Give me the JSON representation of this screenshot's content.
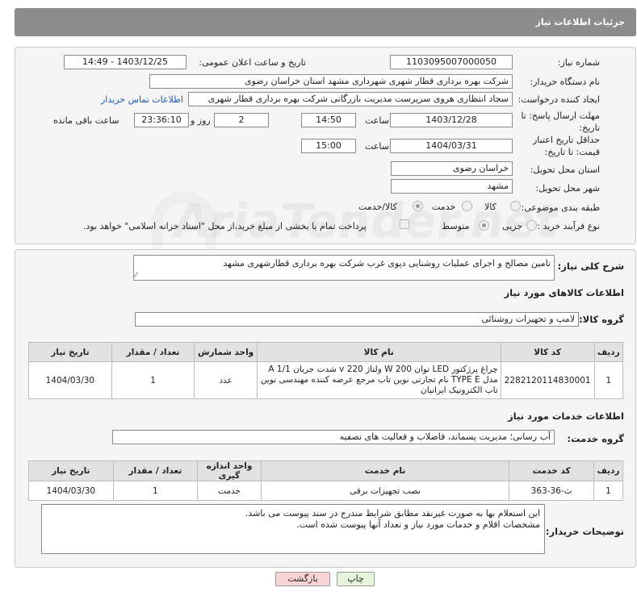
{
  "header": {
    "title": "جزئیات اطلاعات نیاز"
  },
  "form": {
    "need_number_label": "شماره نیاز:",
    "need_number": "1103095007000050",
    "announce_label": "تاریخ و ساعت اعلان عمومی:",
    "announce_value": "1403/12/25 - 14:49",
    "buyer_org_label": "نام دستگاه خریدار:",
    "buyer_org": "شرکت بهره برداری قطار شهری شهرداری مشهد استان خراسان رضوی",
    "requester_label": "ایجاد کننده درخواست:",
    "requester": "سجاد انتظاری هروی سرپرست مدیریت بازرگانی شرکت بهره برداری قطار شهری",
    "contact_link": "اطلاعات تماس خریدار",
    "send_deadline_label": "مهلت ارسال پاسخ: تا تاریخ:",
    "send_deadline_date": "1403/12/28",
    "time_word": "ساعت",
    "send_deadline_time": "14:50",
    "days_value": "2",
    "days_label": "روز و",
    "remaining_time": "23:36:10",
    "remaining_label": "ساعت باقی مانده",
    "price_validity_label": "حداقل تاریخ اعتبار قیمت: تا تاریخ:",
    "price_validity_date": "1404/03/31",
    "price_validity_time": "15:00",
    "province_label": "استان محل تحویل:",
    "province": "خراسان رضوی",
    "city_label": "شهر محل تحویل:",
    "city": "مشهد",
    "category_label": "طبقه بندی موضوعی:",
    "category_options": [
      "کالا",
      "خدمت",
      "کالا/خدمت"
    ],
    "process_label": "نوع فرآیند خرید :",
    "process_options": [
      "جزیی",
      "متوسط"
    ],
    "payment_note": "پرداخت تمام یا بخشی از مبلغ خرید،از محل \"اسناد خزانه اسلامی\" خواهد بود."
  },
  "description": {
    "label": "شرح کلی نیاز:",
    "value": "تامین مصالح و اجرای عملیات روشنایی دپوی غرب شرکت بهره برداری قطارشهری مشهد"
  },
  "goods": {
    "section_title": "اطلاعات کالاهای مورد نیاز",
    "group_label": "گروه کالا:",
    "group_value": "لامپ و تجهیزات روشنائی",
    "columns": [
      "ردیف",
      "کد کالا",
      "نام کالا",
      "واحد شمارش",
      "تعداد / مقدار",
      "تاریخ نیاز"
    ],
    "rows": [
      {
        "row": "1",
        "code": "2282120114830001",
        "name": "چراغ پرژکتور LED توان W 200 ولتاژ 220 v شدت جریان A 1/1 مدل TYPE E نام تجارتی نوین تاب مرجع عرضه کننده مهندسی نوین تاب الکترونیک ایرانیان",
        "unit": "عدد",
        "qty": "1",
        "date": "1404/03/30"
      }
    ]
  },
  "services": {
    "section_title": "اطلاعات خدمات مورد نیاز",
    "group_label": "گروه خدمت:",
    "group_value": "آب رسانی؛ مدیریت پسماند، فاضلاب و فعالیت های تصفیه",
    "columns": [
      "ردیف",
      "کد خدمت",
      "نام خدمت",
      "واحد اندازه گیری",
      "تعداد / مقدار",
      "تاریخ نیاز"
    ],
    "rows": [
      {
        "row": "1",
        "code": "ث-36-363",
        "name": "نصب تجهیزات برقی",
        "unit": "خدمت",
        "qty": "1",
        "date": "1404/03/30"
      }
    ]
  },
  "buyer_notes": {
    "label": "توضیحات خریدار:",
    "line1": "این استعلام بها به صورت غیرنقد مطابق شرایط مندرج در سند پیوست می باشد.",
    "line2": "مشخصات اقلام و خدمات مورد نیاز و تعداد آنها پیوست شده است."
  },
  "buttons": {
    "print": "چاپ",
    "back": "بازگشت"
  },
  "watermark": "AriaTender.net",
  "colors": {
    "header_bg": "#8c8c8c",
    "link": "#1a5db3",
    "back_btn_bg": "#f9d4d4",
    "print_btn_bg": "#e6f4dc"
  }
}
